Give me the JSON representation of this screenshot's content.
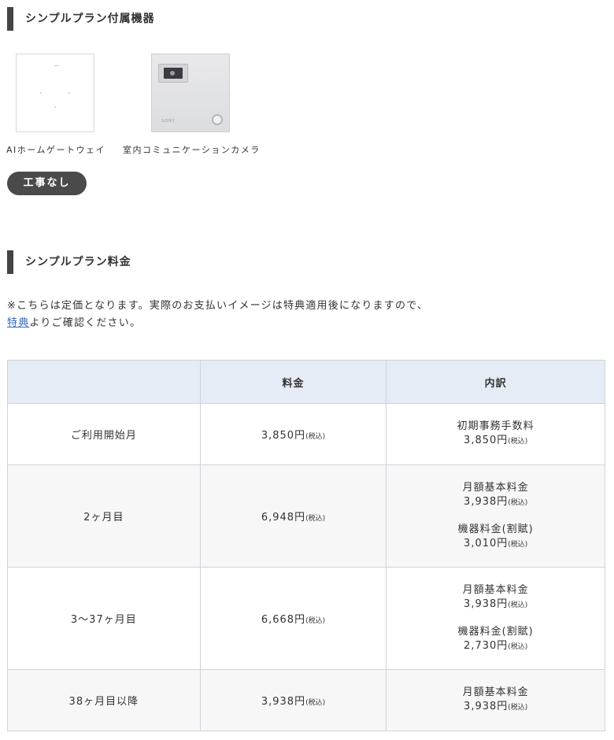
{
  "section1": {
    "title": "シンプルプラン付属機器",
    "devices": [
      {
        "caption": "AIホームゲートウェイ"
      },
      {
        "caption": "室内コミュニケーションカメラ",
        "logo": "SONY"
      }
    ],
    "badge": "工事なし"
  },
  "section2": {
    "title": "シンプルプラン料金",
    "note_line1": "※こちらは定価となります。実際のお支払いイメージは特典適用後になりますので、",
    "note_link": "特典",
    "note_line2_rest": "よりご確認ください。"
  },
  "table": {
    "headers": [
      "",
      "料金",
      "内訳"
    ],
    "tax_label": "(税込)",
    "rows": [
      {
        "period": "ご利用開始月",
        "price": "3,850円",
        "items": [
          {
            "name": "初期事務手数料",
            "amount": "3,850円"
          }
        ]
      },
      {
        "period": "2ヶ月目",
        "price": "6,948円",
        "items": [
          {
            "name": "月額基本料金",
            "amount": "3,938円"
          },
          {
            "name": "機器料金(割賦)",
            "amount": "3,010円"
          }
        ]
      },
      {
        "period": "3～37ヶ月目",
        "price": "6,668円",
        "items": [
          {
            "name": "月額基本料金",
            "amount": "3,938円"
          },
          {
            "name": "機器料金(割賦)",
            "amount": "2,730円"
          }
        ]
      },
      {
        "period": "38ヶ月目以降",
        "price": "3,938円",
        "items": [
          {
            "name": "月額基本料金",
            "amount": "3,938円"
          }
        ]
      }
    ]
  }
}
